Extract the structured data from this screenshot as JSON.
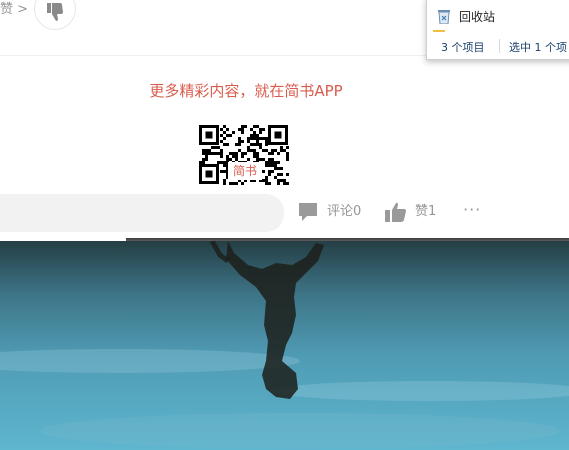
{
  "top": {
    "like_fragment": "赞 >"
  },
  "promo": {
    "text": "更多精彩内容，就在简书APP",
    "qr_label": "简书"
  },
  "explorer": {
    "item_label": "回收站",
    "status_count": "3 个项目",
    "status_selected": "选中 1 个项"
  },
  "action_bar": {
    "comment_placeholder": "",
    "comment_label": "评论0",
    "like_label": "赞1",
    "more_label": "···"
  },
  "colors": {
    "accent": "#d95d4e",
    "muted": "#969696",
    "explorer_text": "#1a3f6b"
  },
  "icons": {
    "dislike": "thumbs-down-icon",
    "recycle_bin": "recycle-bin-icon",
    "comment": "comment-icon",
    "like": "thumbs-up-icon",
    "more": "more-icon"
  }
}
